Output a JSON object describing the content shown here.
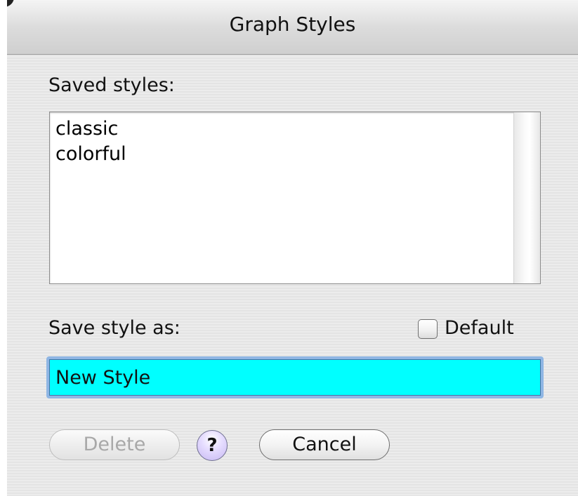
{
  "window": {
    "title": "Graph Styles"
  },
  "saved_styles": {
    "label": "Saved styles:",
    "items": [
      "classic",
      "colorful"
    ]
  },
  "save_as": {
    "label": "Save style as:",
    "value": "New Style",
    "highlight_color": "#00ffff"
  },
  "default_checkbox": {
    "label": "Default",
    "checked": false
  },
  "buttons": {
    "delete_label": "Delete",
    "delete_enabled": false,
    "help_label": "?",
    "cancel_label": "Cancel"
  },
  "icons": {
    "help": "question-mark-icon"
  }
}
